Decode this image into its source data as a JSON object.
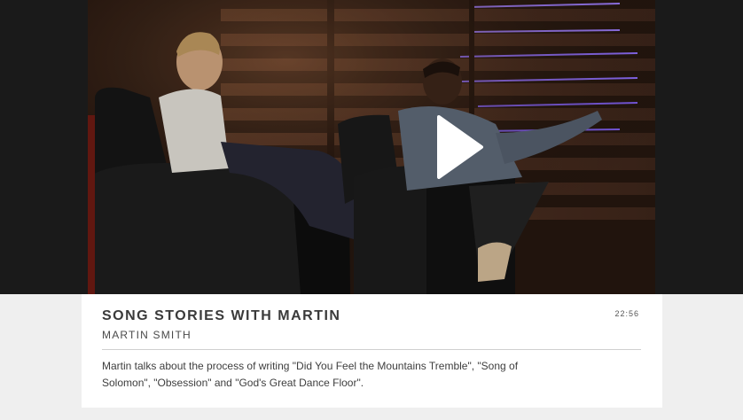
{
  "video": {
    "title": "SONG STORIES WITH MARTIN",
    "speaker": "MARTIN SMITH",
    "duration": "22:56",
    "description": "Martin talks about the process of writing \"Did You Feel the Mountains Tremble\", \"Song of Solomon\", \"Obsession\" and \"God's Great Dance Floor\"."
  },
  "icons": {
    "play": "play-icon"
  },
  "colors": {
    "stage_bg": "#1a1a1a",
    "page_bg": "#efefef",
    "card_bg": "#ffffff",
    "stage_light": "#8a6cff"
  }
}
